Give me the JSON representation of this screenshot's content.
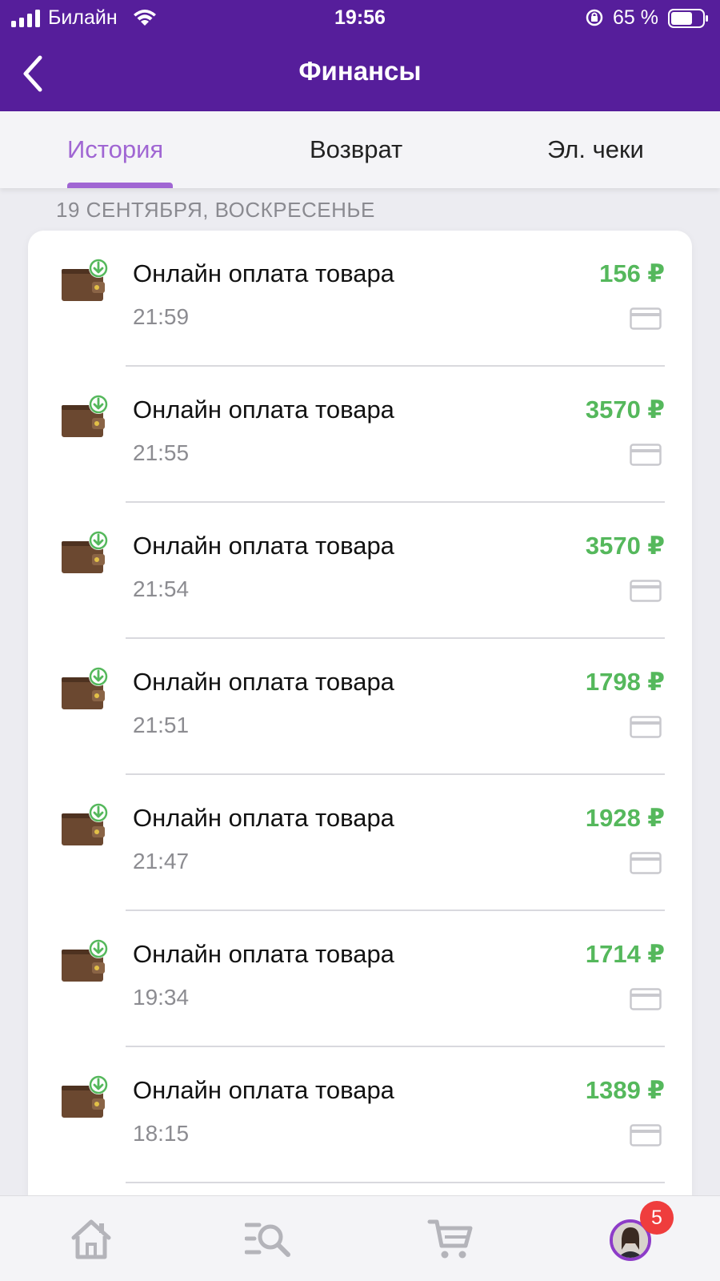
{
  "status_bar": {
    "carrier": "Билайн",
    "time": "19:56",
    "battery": "65 %"
  },
  "header": {
    "title": "Финансы"
  },
  "tabs": [
    {
      "label": "История"
    },
    {
      "label": "Возврат"
    },
    {
      "label": "Эл. чеки"
    }
  ],
  "date_header": "19 СЕНТЯБРЯ, ВОСКРЕСЕНЬЕ",
  "transactions": [
    {
      "title": "Онлайн оплата товара",
      "time": "21:59",
      "amount": "156 ₽"
    },
    {
      "title": "Онлайн оплата товара",
      "time": "21:55",
      "amount": "3570 ₽"
    },
    {
      "title": "Онлайн оплата товара",
      "time": "21:54",
      "amount": "3570 ₽"
    },
    {
      "title": "Онлайн оплата товара",
      "time": "21:51",
      "amount": "1798 ₽"
    },
    {
      "title": "Онлайн оплата товара",
      "time": "21:47",
      "amount": "1928 ₽"
    },
    {
      "title": "Онлайн оплата товара",
      "time": "19:34",
      "amount": "1714 ₽"
    },
    {
      "title": "Онлайн оплата товара",
      "time": "18:15",
      "amount": "1389 ₽"
    }
  ],
  "bottom_nav": {
    "profile_badge": "5",
    "icons": [
      "home-icon",
      "catalog-search-icon",
      "cart-icon",
      "profile-avatar"
    ]
  },
  "colors": {
    "header_bg": "#561e9b",
    "active_tab": "#a066d3",
    "amount": "#55b85c",
    "badge": "#ef3d3d"
  }
}
